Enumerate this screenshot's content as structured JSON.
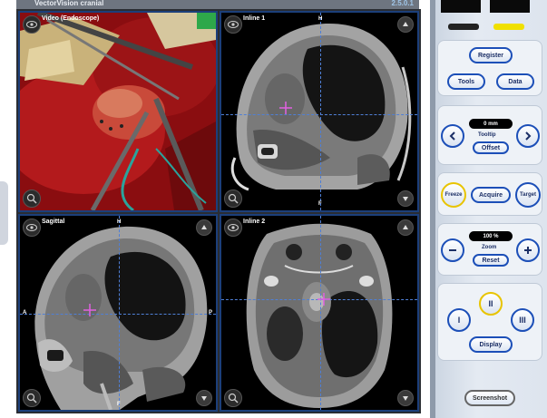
{
  "window": {
    "title": "VectorVision cranial",
    "version": "2.5.0.1"
  },
  "viewports": {
    "video": {
      "label": "Video (Endoscope)"
    },
    "inline1": {
      "label": "Inline 1",
      "top": "H",
      "bottom": "F"
    },
    "sagittal": {
      "label": "Sagittal",
      "top": "H",
      "bottom": "F",
      "left": "A",
      "right": "P"
    },
    "inline2": {
      "label": "Inline 2"
    }
  },
  "buttons": {
    "register": "Register",
    "tools": "Tools",
    "data": "Data",
    "tooltip_value": "0 mm",
    "tooltip": "Tooltip",
    "offset": "Offset",
    "freeze": "Freeze",
    "acquire": "Acquire",
    "target": "Target",
    "zoom_value": "100 %",
    "zoom": "Zoom",
    "reset": "Reset",
    "view1": "I",
    "view2": "II",
    "view3": "III",
    "display": "Display",
    "screenshot": "Screenshot"
  },
  "icons": {
    "eye": "eye-icon",
    "magnifier": "zoom-icon",
    "up": "arrow-up-icon",
    "down": "arrow-down-icon",
    "left": "chevron-left-icon",
    "right": "chevron-right-icon",
    "minus": "minus-icon",
    "plus": "plus-icon"
  },
  "colors": {
    "accent": "#1c4fb8",
    "freeze_ring": "#e8c400",
    "crosshair": "#e060e0",
    "guide": "#4f7fd6",
    "indicator_yellow": "#f0e000"
  }
}
